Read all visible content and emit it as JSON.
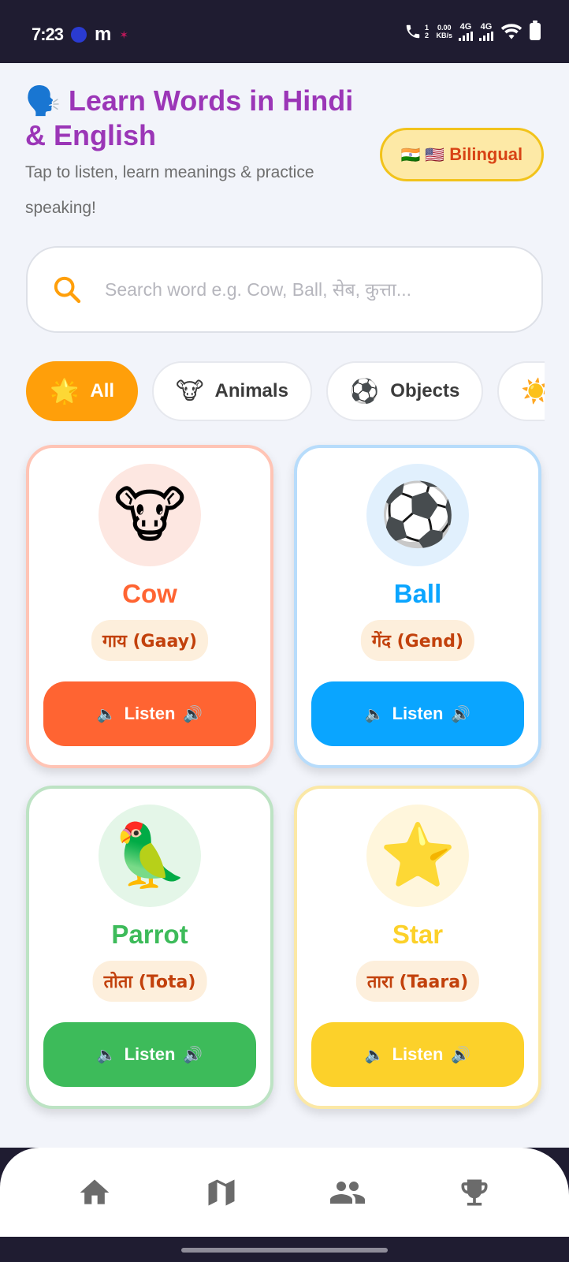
{
  "status_bar": {
    "time": "7:23",
    "app_glyph": "m",
    "call_sim": "1 2",
    "net_speed": "0.00",
    "net_unit": "KB/s",
    "network_1": "4G",
    "network_2": "4G",
    "icons": [
      "meta-circle-icon",
      "dna-icon",
      "call-sim-icon",
      "signal-icon",
      "wifi-icon",
      "battery-icon"
    ]
  },
  "header": {
    "emoji": "🗣️",
    "title": "Learn Words in Hindi & English",
    "subtitle": "Tap to listen, learn meanings & practice speaking!",
    "badge": {
      "flags": "🇮🇳 🇺🇸",
      "label": "Bilingual",
      "color": "#d84315",
      "bg": "#fde9a6"
    }
  },
  "search": {
    "placeholder": "Search word e.g. Cow, Ball, सेब, कुत्ता...",
    "value": "",
    "icon": "search-icon",
    "icon_color": "#ff9f0a"
  },
  "categories": [
    {
      "emoji": "🌟",
      "label": "All",
      "active": true
    },
    {
      "emoji": "🐮",
      "label": "Animals",
      "active": false
    },
    {
      "emoji": "⚽",
      "label": "Objects",
      "active": false
    },
    {
      "emoji": "☀️",
      "label": "",
      "active": false
    }
  ],
  "cards": [
    {
      "emoji": "🐮",
      "english": "Cow",
      "hindi": "गाय (Gaay)",
      "listen_label": "Listen",
      "color": "#ff6432",
      "border": "#ffc4b5",
      "circle": "#fde7e1"
    },
    {
      "emoji": "⚽",
      "english": "Ball",
      "hindi": "गेंद (Gend)",
      "listen_label": "Listen",
      "color": "#0aa5ff",
      "border": "#b7dcfb",
      "circle": "#e1f0fd"
    },
    {
      "emoji": "🦜",
      "english": "Parrot",
      "hindi": "तोता (Tota)",
      "listen_label": "Listen",
      "color": "#3dbb5a",
      "border": "#bde3c4",
      "circle": "#e4f6e8"
    },
    {
      "emoji": "⭐",
      "english": "Star",
      "hindi": "तारा (Taara)",
      "listen_label": "Listen",
      "color": "#fcd12a",
      "border": "#fbe8a6",
      "circle": "#fff6dc"
    }
  ],
  "bottom_nav": [
    {
      "name": "home",
      "icon": "home-icon"
    },
    {
      "name": "map",
      "icon": "map-icon"
    },
    {
      "name": "people",
      "icon": "people-icon"
    },
    {
      "name": "trophy",
      "icon": "trophy-icon"
    }
  ],
  "colors": {
    "title": "#9b36b7",
    "app_bg": "#f2f4fa",
    "nav_icon": "#6b6b6b"
  }
}
